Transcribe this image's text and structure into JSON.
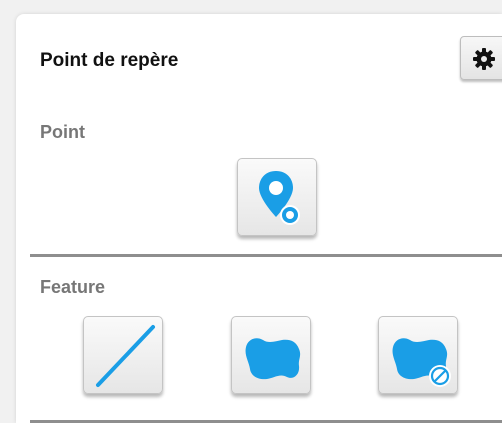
{
  "panel": {
    "title": "Point de repère"
  },
  "point_section": {
    "label": "Point"
  },
  "feature_section": {
    "label": "Feature"
  },
  "icons": {
    "settings": "gear-icon",
    "point": "map-pin-icon",
    "line": "line-icon",
    "polygon": "polygon-icon",
    "polygon_remove": "polygon-remove-icon"
  },
  "colors": {
    "accent": "#1a9ee6",
    "section_label": "#777777",
    "title": "#111111"
  }
}
